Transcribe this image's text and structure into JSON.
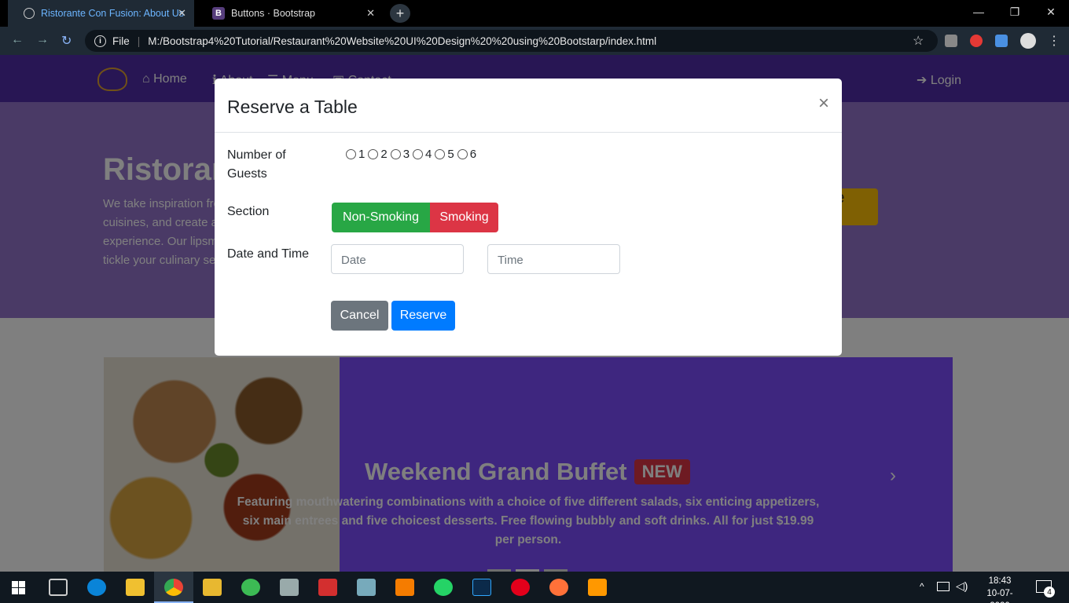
{
  "browser": {
    "tabs": [
      {
        "title": "Ristorante Con Fusion: About Us",
        "active": true
      },
      {
        "title": "Buttons · Bootstrap",
        "favicon": "B",
        "active": false
      }
    ],
    "new_tab": "+",
    "close_tab": "✕",
    "window_controls": {
      "minimize": "—",
      "maximize": "❐",
      "close": "✕"
    },
    "address": {
      "scheme_label": "File",
      "url": "M:/Bootstrap4%20Tutorial/Restaurant%20Website%20UI%20Design%20%20using%20Bootstarp/index.html"
    }
  },
  "site": {
    "nav": {
      "home": "Home",
      "about": "About",
      "menu": "Menu",
      "contact": "Contact",
      "login": "Login"
    },
    "jumbotron": {
      "title": "Ristorante con Fusion",
      "text": "We take inspiration from the World's best cuisines, and create a unique fusion experience. Our lipsmacking creations will tickle your culinary senses!",
      "reserve_button": "Reserve Table"
    },
    "carousel": {
      "title": "Weekend Grand Buffet",
      "badge": "NEW",
      "text": "Featuring mouthwatering combinations with a choice of five different salads, six enticing appetizers, six main entrees and five choicest desserts. Free flowing bubbly and soft drinks. All for just $19.99 per person.",
      "next_icon": "›"
    }
  },
  "modal": {
    "title": "Reserve a Table",
    "close": "×",
    "guests_label": "Number of Guests",
    "guest_options": [
      "1",
      "2",
      "3",
      "4",
      "5",
      "6"
    ],
    "section_label": "Section",
    "section_options": [
      "Non-Smoking",
      "Smoking"
    ],
    "datetime_label": "Date and Time",
    "date_placeholder": "Date",
    "time_placeholder": "Time",
    "cancel": "Cancel",
    "reserve": "Reserve"
  },
  "taskbar": {
    "time": "18:43",
    "date": "10-07-2020",
    "notification_count": "4"
  },
  "colors": {
    "nav": "#512da8",
    "jumbotron": "#9575cd",
    "success": "#28a745",
    "danger": "#dc3545",
    "primary": "#007bff",
    "secondary": "#6c757d"
  }
}
